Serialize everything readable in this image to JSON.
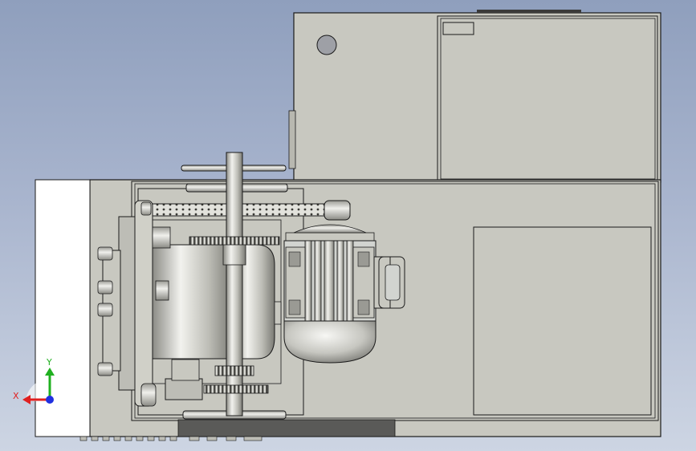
{
  "viewport": {
    "background_top": "#8f9fbd",
    "background_bottom": "#cdd5e3"
  },
  "triad": {
    "x_label": "X",
    "y_label": "Y",
    "x_color": "#e02020",
    "y_color": "#20b020",
    "z_color": "#2030e0"
  },
  "model": {
    "body_color": "#c8c8c0",
    "edge_color": "#1a1a1a",
    "motor_color": "#d2d4d0",
    "dark_part_color": "#555555",
    "white_panel_color": "#ffffff"
  }
}
